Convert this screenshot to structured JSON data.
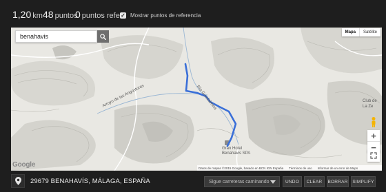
{
  "stats": {
    "distance_value": "1,20",
    "distance_unit": "km",
    "points_value": "48",
    "points_unit": "puntos",
    "ref_value": "0",
    "ref_unit": "puntos refer.",
    "show_ref_label": "Mostrar puntos de referencia",
    "show_ref_checked": true
  },
  "map": {
    "search_value": "benahavis",
    "map_type_active": "Mapa",
    "map_type_other": "Satélite",
    "labels": {
      "river1": "Arroyo de las Angosturas",
      "river2": "Río Guadalmina",
      "hotel_line1": "Gran Hotel",
      "hotel_line2": "Benahavis SPA",
      "club_line1": "Club de",
      "club_line2": "La Ze"
    },
    "zoom_in": "+",
    "zoom_out": "−",
    "logo": "Google",
    "attribution": {
      "data": "Datos de mapas ©2015 Google, basado en BCN IGN España",
      "terms": "Términos de uso",
      "report": "Informar de un error de Maps"
    },
    "route_color": "#3a6fd8",
    "icons": {
      "search": "search-icon",
      "pegman": "pegman-icon",
      "fullscreen": "fullscreen-icon"
    }
  },
  "footer": {
    "location": "29679 BENAHAVÍS, MÁLAGA, ESPAÑA",
    "route_mode": "Sigue carreteras caminando",
    "buttons": {
      "undo": "UNDO",
      "clear": "CLEAR",
      "delete": "BORRAR",
      "simplify": "SIMPLIFY"
    }
  }
}
